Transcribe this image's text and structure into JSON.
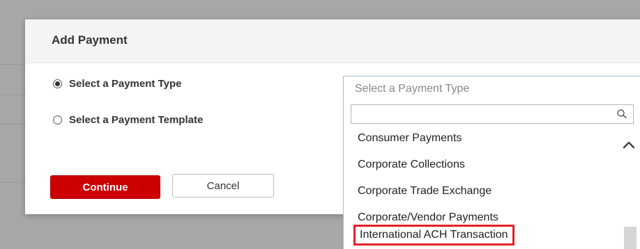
{
  "modal": {
    "title": "Add Payment",
    "options": [
      {
        "label": "Select a Payment Type",
        "checked": true
      },
      {
        "label": "Select a Payment Template",
        "checked": false
      }
    ],
    "continue_label": "Continue",
    "cancel_label": "Cancel"
  },
  "select": {
    "placeholder": "Select a Payment Type",
    "search_value": "",
    "items": [
      "Consumer Payments",
      "Corporate Collections",
      "Corporate Trade Exchange",
      "Corporate/Vendor Payments",
      "International ACH Transaction"
    ],
    "highlighted_item": "International ACH Transaction"
  },
  "colors": {
    "primary_button": "#cc0000",
    "highlight_border": "#e3202a",
    "select_border": "#9fbbd6"
  },
  "icons": {
    "search": "search-icon",
    "scroll_up": "chevron-up-icon"
  }
}
